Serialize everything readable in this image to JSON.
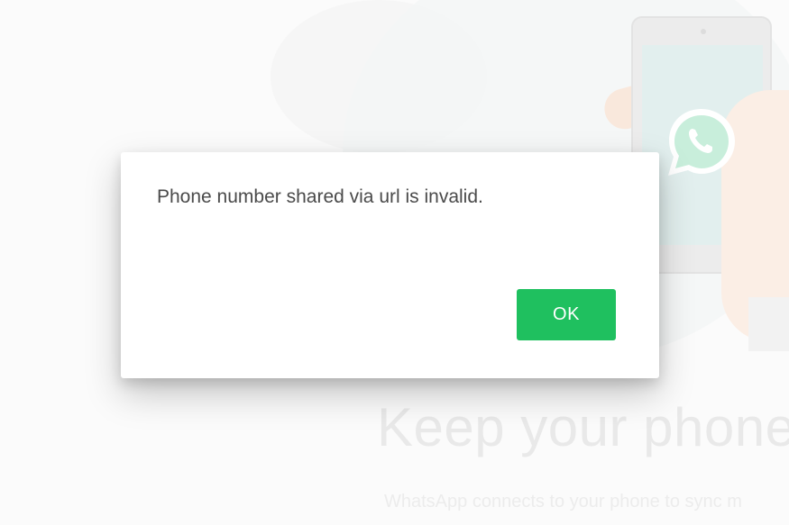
{
  "background": {
    "heading": "Keep your phone c",
    "subtext": "WhatsApp connects to your phone to sync m",
    "logo_icon": "whatsapp-logo-icon"
  },
  "dialog": {
    "message": "Phone number shared via url is invalid.",
    "ok_label": "OK"
  },
  "colors": {
    "accent": "#1fc05f",
    "whatsapp_green": "#25d366"
  }
}
